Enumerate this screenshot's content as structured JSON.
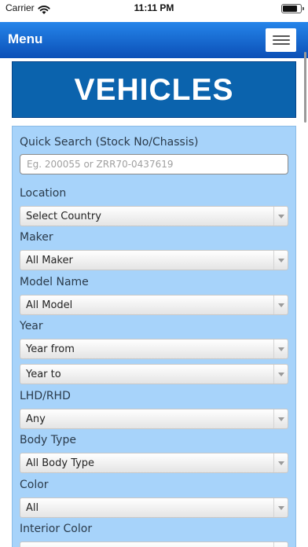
{
  "status_bar": {
    "carrier": "Carrier",
    "time": "11:11 PM"
  },
  "nav": {
    "title": "Menu"
  },
  "banner": {
    "title": "VEHICLES"
  },
  "search": {
    "label": "Quick Search (Stock No/Chassis)",
    "placeholder": "Eg. 200055 or ZRR70-0437619"
  },
  "filters": {
    "location_label": "Location",
    "location_value": "Select Country",
    "maker_label": "Maker",
    "maker_value": "All Maker",
    "model_label": "Model Name",
    "model_value": "All Model",
    "year_label": "Year",
    "year_from_value": "Year from",
    "year_to_value": "Year to",
    "lhd_label": "LHD/RHD",
    "lhd_value": "Any",
    "body_label": "Body Type",
    "body_value": "All Body Type",
    "color_label": "Color",
    "color_value": "All",
    "interior_label": "Interior Color"
  },
  "colors": {
    "nav_top": "#2585ea",
    "nav_bottom": "#0b4fb6",
    "banner": "#0b63ad",
    "panel": "#a7d3fa"
  }
}
